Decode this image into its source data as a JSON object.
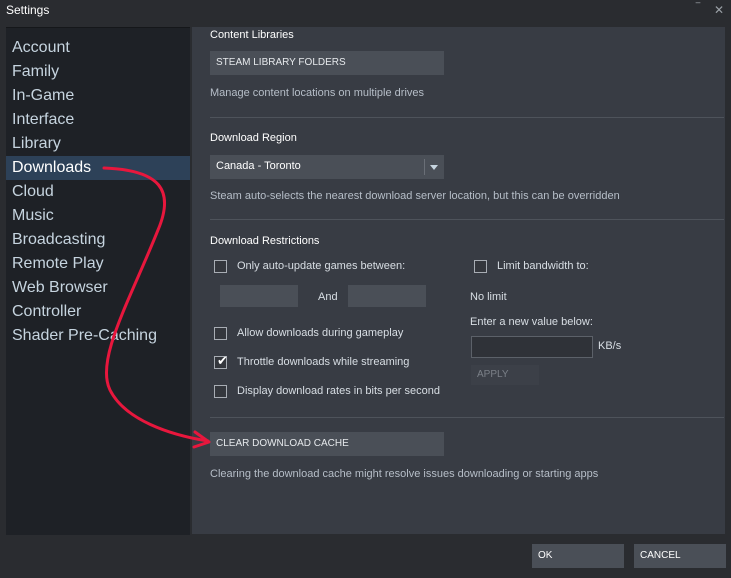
{
  "window": {
    "title": "Settings",
    "minimize_glyph": "‾",
    "close_glyph": "✕"
  },
  "sidebar": {
    "items": [
      {
        "label": "Account"
      },
      {
        "label": "Family"
      },
      {
        "label": "In-Game"
      },
      {
        "label": "Interface"
      },
      {
        "label": "Library"
      },
      {
        "label": "Downloads",
        "active": true
      },
      {
        "label": "Cloud"
      },
      {
        "label": "Music"
      },
      {
        "label": "Broadcasting"
      },
      {
        "label": "Remote Play"
      },
      {
        "label": "Web Browser"
      },
      {
        "label": "Controller"
      },
      {
        "label": "Shader Pre-Caching"
      }
    ]
  },
  "content_libraries": {
    "title": "Content Libraries",
    "button": "STEAM LIBRARY FOLDERS",
    "description": "Manage content locations on multiple drives"
  },
  "download_region": {
    "title": "Download Region",
    "selected": "Canada - Toronto",
    "description": "Steam auto-selects the nearest download server location, but this can be overridden"
  },
  "download_restrictions": {
    "title": "Download Restrictions",
    "auto_update_label": "Only auto-update games between:",
    "auto_update_checked": false,
    "and_label": "And",
    "allow_gameplay_label": "Allow downloads during gameplay",
    "allow_gameplay_checked": false,
    "throttle_label": "Throttle downloads while streaming",
    "throttle_checked": true,
    "bits_label": "Display download rates in bits per second",
    "bits_checked": false,
    "limit_bandwidth_label": "Limit bandwidth to:",
    "limit_bandwidth_checked": false,
    "no_limit_label": "No limit",
    "new_value_label": "Enter a new value below:",
    "unit": "KB/s",
    "apply_label": "APPLY",
    "check_glyph": "✔"
  },
  "cache": {
    "button": "CLEAR DOWNLOAD CACHE",
    "description": "Clearing the download cache might resolve issues downloading or starting apps"
  },
  "footer": {
    "ok": "OK",
    "cancel": "CANCEL"
  },
  "colors": {
    "annotation_arrow": "#e8173d",
    "active_item_bg": "#2d4158"
  }
}
